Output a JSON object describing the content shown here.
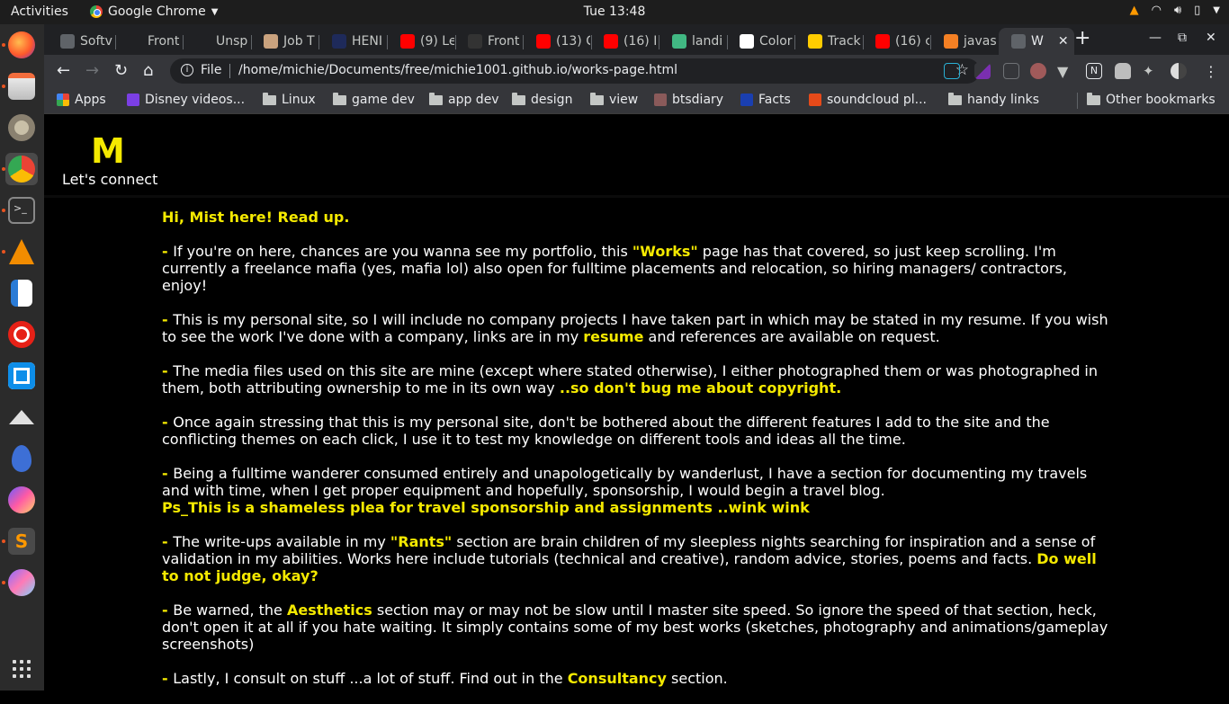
{
  "system": {
    "activities": "Activities",
    "app_name": "Google Chrome",
    "clock": "Tue 13:48"
  },
  "tabs": [
    {
      "label": "Softv",
      "fav_color": "#5f6368"
    },
    {
      "label": "Front",
      "fav_color": "#202124"
    },
    {
      "label": "Unsp",
      "fav_color": "#202124"
    },
    {
      "label": "Job T",
      "fav_color": "#c9a27e"
    },
    {
      "label": "HENI",
      "fav_color": "#1e2a5a"
    },
    {
      "label": "(9) Le",
      "fav_color": "#ff0000"
    },
    {
      "label": "Front",
      "fav_color": "#333333"
    },
    {
      "label": "(13) C",
      "fav_color": "#ff0000"
    },
    {
      "label": "(16) I",
      "fav_color": "#ff0000"
    },
    {
      "label": "landi",
      "fav_color": "#41b883"
    },
    {
      "label": "Color",
      "fav_color": "#ffffff"
    },
    {
      "label": "Track",
      "fav_color": "#ffcc00"
    },
    {
      "label": "(16) c",
      "fav_color": "#ff0000"
    },
    {
      "label": "javas",
      "fav_color": "#f48024"
    },
    {
      "label": "W",
      "fav_color": "#5f6368",
      "active": true
    }
  ],
  "omnibox": {
    "scheme": "File",
    "url": "/home/michie/Documents/free/michie1001.github.io/works-page.html"
  },
  "bookmarks": [
    {
      "label": "Apps",
      "type": "apps"
    },
    {
      "label": "Disney videos...",
      "type": "fav",
      "color": "#7b3fe4"
    },
    {
      "label": "Linux",
      "type": "folder"
    },
    {
      "label": "game dev",
      "type": "folder"
    },
    {
      "label": "app dev",
      "type": "folder"
    },
    {
      "label": "design",
      "type": "folder"
    },
    {
      "label": "view",
      "type": "folder"
    },
    {
      "label": "btsdiary",
      "type": "fav",
      "color": "#8a5a5a"
    },
    {
      "label": "Facts",
      "type": "fav",
      "color": "#1a3fb0"
    },
    {
      "label": "soundcloud pl...",
      "type": "fav",
      "color": "#e64a19"
    },
    {
      "label": "handy links",
      "type": "folder"
    }
  ],
  "other_bookmarks": "Other bookmarks",
  "site": {
    "logo": "M",
    "connect": "Let's connect",
    "greeting": "Hi, Mist here! Read up.",
    "bullet": "- ",
    "p1": {
      "a": "If you're on here, chances are you wanna see my portfolio, this ",
      "b": "\"Works\"",
      "c": " page has that covered, so just keep scrolling. I'm currently a freelance mafia (yes, mafia lol) also open for fulltime placements and relocation, so hiring managers/ contractors, enjoy!"
    },
    "p2": {
      "a": "This is my personal site, so I will include no company projects I have taken part in which may be stated in my resume. If you wish to see the work I've done with a company, links are in my ",
      "b": "resume",
      "c": " and references are available on request."
    },
    "p3": {
      "a": "The media files used on this site are mine (except where stated otherwise), I either photographed them or was photographed in them, both attributing ownership to me in its own way ",
      "b": "..so don't bug me about copyright."
    },
    "p4": {
      "a": "Once again stressing that this is my personal site, don't be bothered about the different features I add to the site and the conflicting themes on each click, I use it to test my knowledge on different tools and ideas all the time."
    },
    "p5": {
      "a": "Being a fulltime wanderer consumed entirely and unapologetically by wanderlust, I have a section for documenting my travels and with time, when I get proper equipment and hopefully, sponsorship, I would begin a travel blog.",
      "b": "Ps_This is a shameless plea for travel sponsorship and assignments ..wink wink"
    },
    "p6": {
      "a": "The write-ups available in my ",
      "b": "\"Rants\"",
      "c": " section are brain children of my sleepless nights searching for inspiration and a sense of validation in my abilities. Works here include tutorials (technical and creative), random advice, stories, poems and facts. ",
      "d": "Do well to not judge, okay?"
    },
    "p7": {
      "a": "Be warned, the ",
      "b": "Aesthetics",
      "c": " section may or may not be slow until I master site speed. So ignore the speed of that section, heck, don't open it at all if you hate waiting. It simply contains some of my best works (sketches, photography and animations/gameplay screenshots)"
    },
    "p8": {
      "a": "Lastly, I consult on stuff ...a lot of stuff. Find out in the ",
      "b": "Consultancy",
      "c": " section."
    }
  }
}
